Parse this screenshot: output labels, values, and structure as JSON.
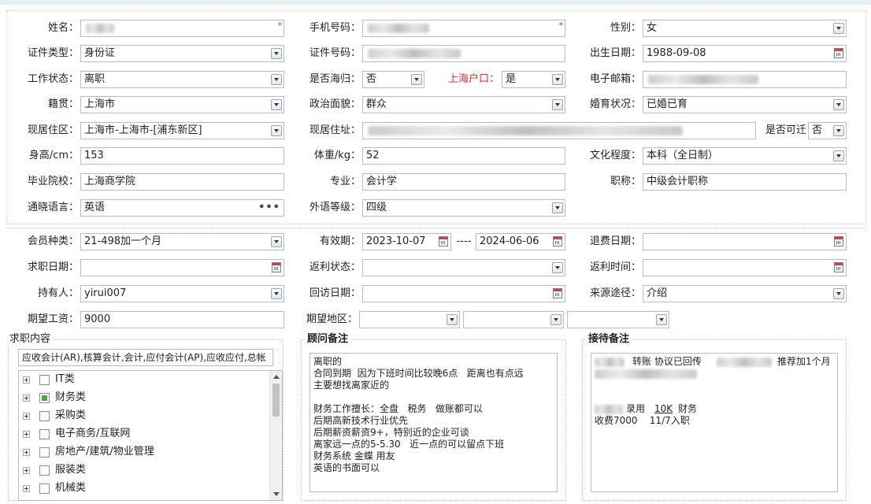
{
  "labels": {
    "name": "姓名：",
    "phone": "手机号码：",
    "gender": "性别：",
    "id_type": "证件类型：",
    "id_no": "证件号码：",
    "birth": "出生日期：",
    "work_status": "工作状态：",
    "returnee": "是否海归：",
    "shanghai_hukou": "上海户口：",
    "email": "电子邮箱：",
    "native_place": "籍贯：",
    "political": "政治面貌：",
    "marital": "婚育状况：",
    "residence_area": "现居住区：",
    "residence_address": "现居住址：",
    "can_move": "是否可迁",
    "height": "身高/cm：",
    "weight": "体重/kg：",
    "education": "文化程度：",
    "school": "毕业院校：",
    "major": "专业：",
    "title": "职称：",
    "language": "通晓语言：",
    "foreign_level": "外语等级：",
    "member_type": "会员种类：",
    "validity": "有效期：",
    "validity_sep": "----",
    "refund_date": "退费日期：",
    "job_date": "求职日期：",
    "rebate_status": "返利状态：",
    "rebate_time": "返利时间：",
    "holder": "持有人：",
    "revisit_date": "回访日期：",
    "source": "来源途径：",
    "expected_salary": "期望工资：",
    "expected_region": "期望地区："
  },
  "values": {
    "gender": "女",
    "id_type": "身份证",
    "birth": "1988-09-08",
    "work_status": "离职",
    "returnee": "否",
    "shanghai_hukou": "是",
    "native_place": "上海市",
    "political": "群众",
    "marital": "已婚已育",
    "residence_area": "上海市-上海市-[浦东新区]",
    "can_move": "否",
    "height": "153",
    "weight": "52",
    "education": "本科（全日制）",
    "school": "上海商学院",
    "major": "会计学",
    "title": "中级会计职称",
    "language": "英语",
    "foreign_level": "四级",
    "member_type": "21-498加一个月",
    "validity_start": "2023-10-07",
    "validity_end": "2024-06-06",
    "holder": "yirui007",
    "source": "介绍",
    "expected_salary": "9000"
  },
  "required_mark": "*",
  "job_content": {
    "legend": "求职内容",
    "summary": "应收会计(AR),核算会计,会计,应付会计(AP),应收应付,总帐",
    "items": [
      {
        "label": "IT类",
        "checked": false
      },
      {
        "label": "财务类",
        "checked": true
      },
      {
        "label": "采购类",
        "checked": false
      },
      {
        "label": "电子商务/互联网",
        "checked": false
      },
      {
        "label": "房地产/建筑/物业管理",
        "checked": false
      },
      {
        "label": "服装类",
        "checked": false
      },
      {
        "label": "机械类",
        "checked": false
      }
    ]
  },
  "consultant_note": {
    "legend": "顾问备注",
    "text": "离职的\n合同到期  因为下班时间比较晚6点   距离也有点远\n主要想找离家近的\n\n财务工作擅长：全盘   税务   做账都可以\n后期高新技术行业优先\n后期薪资薪资9+，特别近的企业可谈\n离家远一点的5-5.30   近一点的可以留点下班\n财务系统 金蝶 用友\n英语的书面可以"
  },
  "reception_note": {
    "legend": "接待备注",
    "line1_a": "转账   协议已回传",
    "line1_b": "推荐加1个月",
    "line2_a": "录用",
    "line2_b": "10K",
    "line2_c": "财务",
    "line3": "收费7000    11/7入职"
  },
  "colors": {
    "accent_red": "#d62a2a",
    "checked_green": "#4aa844"
  }
}
